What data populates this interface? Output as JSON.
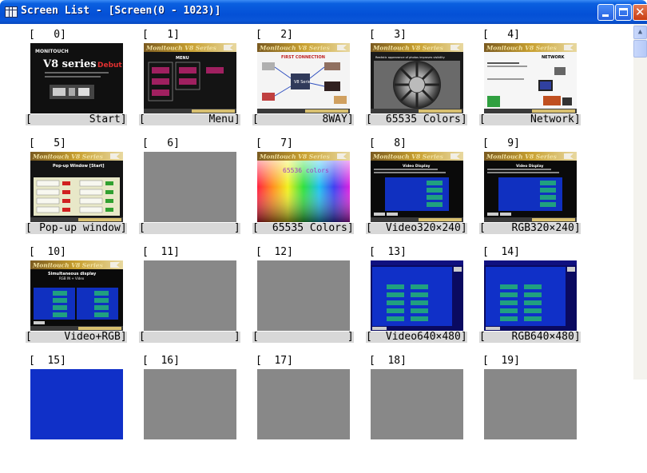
{
  "window": {
    "title": "Screen List - [Screen(0 - 1023)]",
    "controls": [
      "minimize",
      "maximize",
      "close"
    ]
  },
  "screens": [
    {
      "index": "[   0]",
      "label": "Start",
      "thumb": "start"
    },
    {
      "index": "[   1]",
      "label": "Menu",
      "thumb": "menu"
    },
    {
      "index": "[   2]",
      "label": "8WAY",
      "thumb": "8way"
    },
    {
      "index": "[   3]",
      "label": "65535 Colors",
      "thumb": "wheel"
    },
    {
      "index": "[   4]",
      "label": "Network",
      "thumb": "network"
    },
    {
      "index": "[   5]",
      "label": "Pop-up window",
      "thumb": "popup"
    },
    {
      "index": "[   6]",
      "label": "",
      "thumb": "empty"
    },
    {
      "index": "[   7]",
      "label": "65535 Colors",
      "thumb": "spectrum"
    },
    {
      "index": "[   8]",
      "label": "Video320×240",
      "thumb": "video"
    },
    {
      "index": "[   9]",
      "label": "RGB320×240",
      "thumb": "video"
    },
    {
      "index": "[  10]",
      "label": "Video+RGB",
      "thumb": "videorgb"
    },
    {
      "index": "[  11]",
      "label": "",
      "thumb": "empty"
    },
    {
      "index": "[  12]",
      "label": "",
      "thumb": "empty"
    },
    {
      "index": "[  13]",
      "label": "Video640×480",
      "thumb": "bluewin"
    },
    {
      "index": "[  14]",
      "label": "RGB640×480",
      "thumb": "bluewin"
    },
    {
      "index": "[  15]",
      "label": "",
      "thumb": "bluefull"
    },
    {
      "index": "[  16]",
      "label": "",
      "thumb": "empty"
    },
    {
      "index": "[  17]",
      "label": "",
      "thumb": "empty"
    },
    {
      "index": "[  18]",
      "label": "",
      "thumb": "empty"
    },
    {
      "index": "[  19]",
      "label": "",
      "thumb": "empty"
    }
  ],
  "thumb_text": {
    "start_brand": "MONITOUCH",
    "start_title": "V8 series",
    "start_debut": "Debut!",
    "series_header": "Monitouch V8 Series",
    "menu_heading": "MENU",
    "network_heading": "NETWORK",
    "popup_heading": "Pop-up Window [Start]",
    "spectrum_text": "65536 colors",
    "video_heading": "Video Display",
    "rgb_heading": "RGB INPUT",
    "videorgb_heading": "Simultaneous display",
    "videorgb_sub": "RGB IN + Video",
    "way_heading": "FIRST CONNECTION",
    "way_center": "V8 Series",
    "wheel_heading": "Realistic appearance of photos improves visibility"
  },
  "colors": {
    "titlebar": "#0a56d8",
    "empty_thumb": "#888888",
    "label_bar": "#d8d8d8",
    "header_gold": "#c8a030"
  }
}
